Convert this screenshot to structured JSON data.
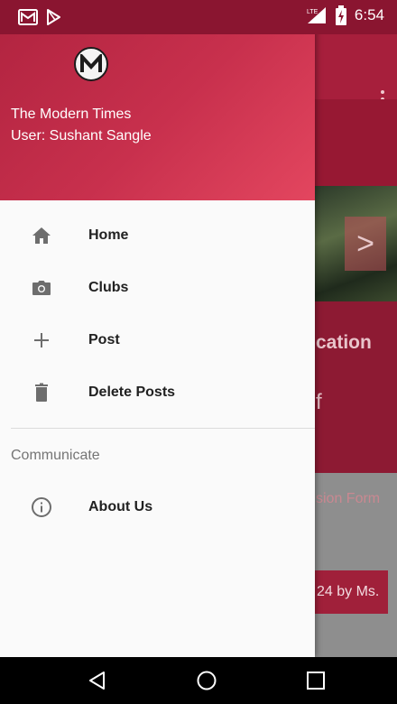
{
  "status_bar": {
    "time": "6:54",
    "network_badge": "LTE",
    "icons": [
      "gmail-icon",
      "play-store-icon",
      "signal-icon",
      "battery-charging-icon"
    ]
  },
  "background": {
    "heading_fragment": "cation",
    "text_fragment": "f",
    "form_fragment": "sion Form",
    "chip_fragment": "24 by Ms.",
    "arrow_glyph": ">"
  },
  "drawer": {
    "header": {
      "logo_letter": "M",
      "title": "The Modern Times",
      "user": "User: Sushant Sangle"
    },
    "menu_items": [
      {
        "label": "Home",
        "icon": "home-icon"
      },
      {
        "label": "Clubs",
        "icon": "camera-icon"
      },
      {
        "label": "Post",
        "icon": "plus-icon"
      },
      {
        "label": "Delete Posts",
        "icon": "trash-icon"
      }
    ],
    "section_label": "Communicate",
    "communicate_items": [
      {
        "label": "About Us",
        "icon": "info-icon"
      }
    ]
  },
  "nav_bar": {
    "buttons": [
      "back-icon",
      "home-circle-icon",
      "recents-icon"
    ]
  },
  "colors": {
    "header_start": "#b0233f",
    "header_end": "#e3465f",
    "status_bar": "#8a1530"
  }
}
